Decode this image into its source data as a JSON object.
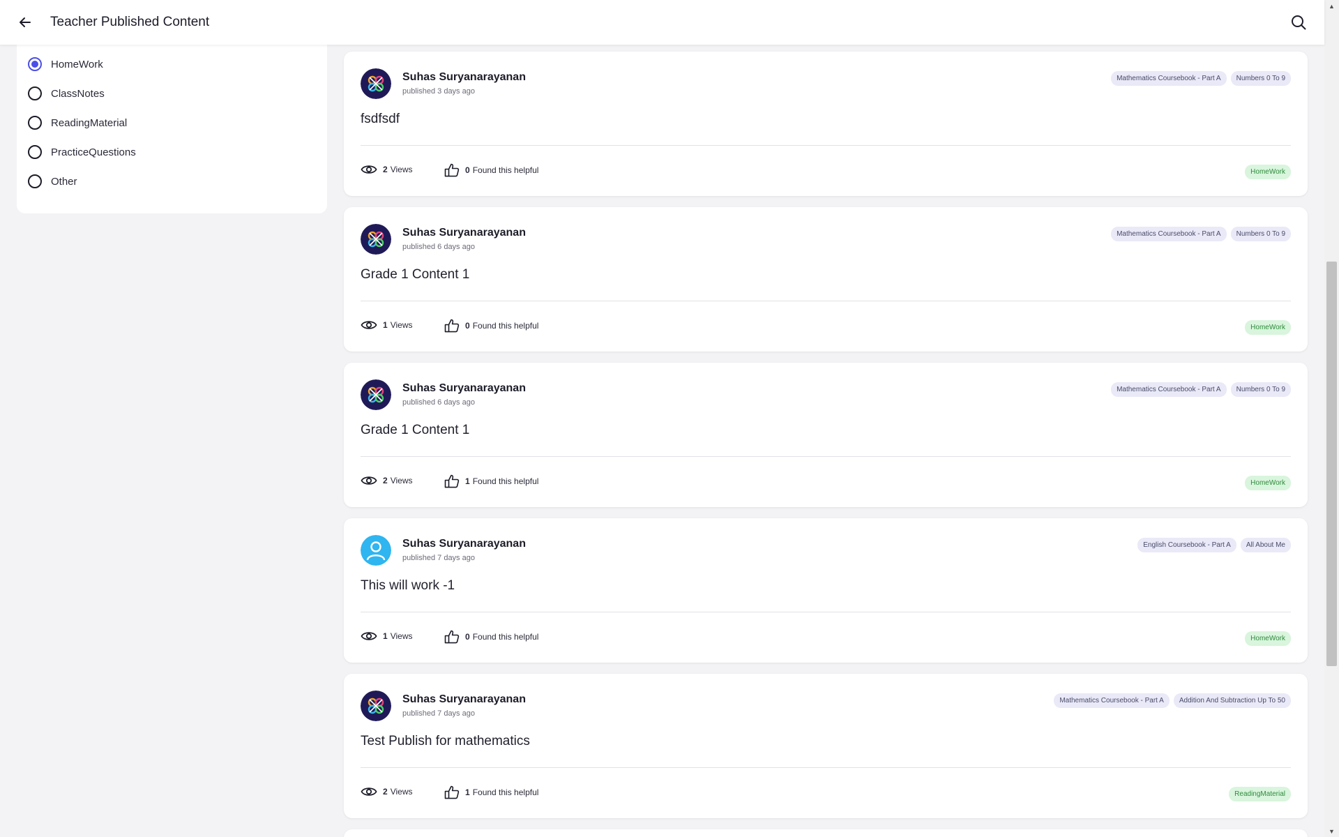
{
  "header": {
    "title": "Teacher Published Content",
    "back_icon": "arrow-left-icon",
    "search_icon": "search-icon"
  },
  "filters": {
    "selected": "HomeWork",
    "options": [
      {
        "label": "HomeWork",
        "checked": true
      },
      {
        "label": "ClassNotes",
        "checked": false
      },
      {
        "label": "ReadingMaterial",
        "checked": false
      },
      {
        "label": "PracticeQuestions",
        "checked": false
      },
      {
        "label": "Other",
        "checked": false
      }
    ]
  },
  "posts": [
    {
      "author": "Suhas Suryanarayanan",
      "published": "published 3 days ago",
      "avatar": "logo",
      "tags": [
        "Mathematics Coursebook - Part A",
        "Numbers 0 To 9"
      ],
      "title": "fsdfsdf",
      "views_count": "2",
      "views_label": "Views",
      "helpful_count": "0",
      "helpful_label": "Found this helpful",
      "category": "HomeWork"
    },
    {
      "author": "Suhas Suryanarayanan",
      "published": "published 6 days ago",
      "avatar": "logo",
      "tags": [
        "Mathematics Coursebook - Part A",
        "Numbers 0 To 9"
      ],
      "title": "Grade 1 Content 1",
      "views_count": "1",
      "views_label": "Views",
      "helpful_count": "0",
      "helpful_label": "Found this helpful",
      "category": "HomeWork"
    },
    {
      "author": "Suhas Suryanarayanan",
      "published": "published 6 days ago",
      "avatar": "logo",
      "tags": [
        "Mathematics Coursebook - Part A",
        "Numbers 0 To 9"
      ],
      "title": "Grade 1 Content 1",
      "views_count": "2",
      "views_label": "Views",
      "helpful_count": "1",
      "helpful_label": "Found this helpful",
      "category": "HomeWork"
    },
    {
      "author": "Suhas Suryanarayanan",
      "published": "published 7 days ago",
      "avatar": "person",
      "tags": [
        "English Coursebook - Part A",
        "All About Me"
      ],
      "title": "This will work -1",
      "views_count": "1",
      "views_label": "Views",
      "helpful_count": "0",
      "helpful_label": "Found this helpful",
      "category": "HomeWork"
    },
    {
      "author": "Suhas Suryanarayanan",
      "published": "published 7 days ago",
      "avatar": "logo",
      "tags": [
        "Mathematics Coursebook - Part A",
        "Addition And Subtraction Up To 50"
      ],
      "title": "Test Publish for mathematics",
      "views_count": "2",
      "views_label": "Views",
      "helpful_count": "1",
      "helpful_label": "Found this helpful",
      "category": "ReadingMaterial"
    }
  ],
  "colors": {
    "accent": "#4b4fe6",
    "avatar_bg": "#1f1a57",
    "person_avatar_bg": "#2fb5f0",
    "category_bg": "#d9f5dd",
    "category_text": "#2f8a3d",
    "tag_bg": "#e9e9f7"
  }
}
